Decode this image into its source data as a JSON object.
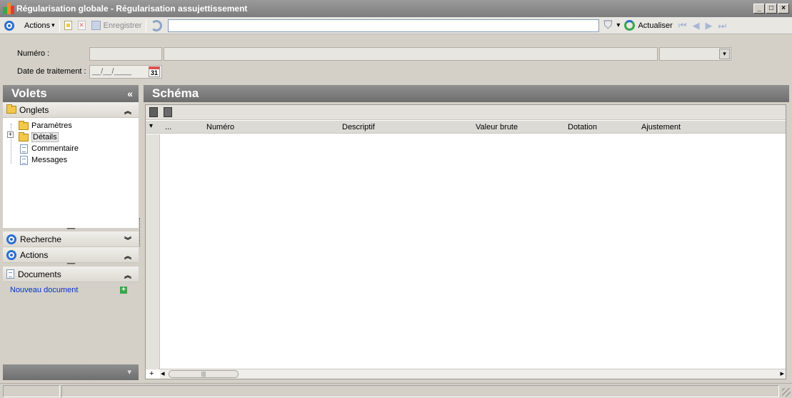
{
  "window": {
    "title": "Régularisation globale - Régularisation assujettissement",
    "min": "_",
    "max": "□",
    "close": "×"
  },
  "toolbar": {
    "actions_label": "Actions",
    "save_label": "Enregistrer",
    "search_value": "",
    "refresh_label": "Actualiser"
  },
  "form": {
    "numero_label": "Numéro :",
    "date_label": "Date de traitement :",
    "date_value": "__/__/____",
    "calendar_day": "31"
  },
  "left_panel": {
    "title": "Volets",
    "onglets": {
      "label": "Onglets",
      "items": [
        "Paramètres",
        "Détails",
        "Commentaire",
        "Messages"
      ]
    },
    "recherche_label": "Recherche",
    "actions_label": "Actions",
    "documents": {
      "label": "Documents",
      "new_link": "Nouveau document"
    }
  },
  "right_panel": {
    "title": "Schéma",
    "columns": [
      "...",
      "Numéro",
      "Descriptif",
      "Valeur brute",
      "Dotation",
      "Ajustement"
    ]
  },
  "icons": {
    "collapse_left": "«",
    "chevron_up": "︽",
    "chevron_down": "︾",
    "dropdown": "▾",
    "filter": "⛉",
    "first": "⏮",
    "prev": "◀",
    "next": "▶",
    "last": "⏭",
    "expander": "+",
    "plus": "+",
    "scroll_left": "◂",
    "scroll_right": "▸",
    "grip": "••••••••••",
    "thumb_grip": "|||"
  },
  "colors": {
    "header_gray": "#7d7d7d",
    "link_blue": "#0033cc",
    "accent_blue": "#2d6fcf"
  }
}
